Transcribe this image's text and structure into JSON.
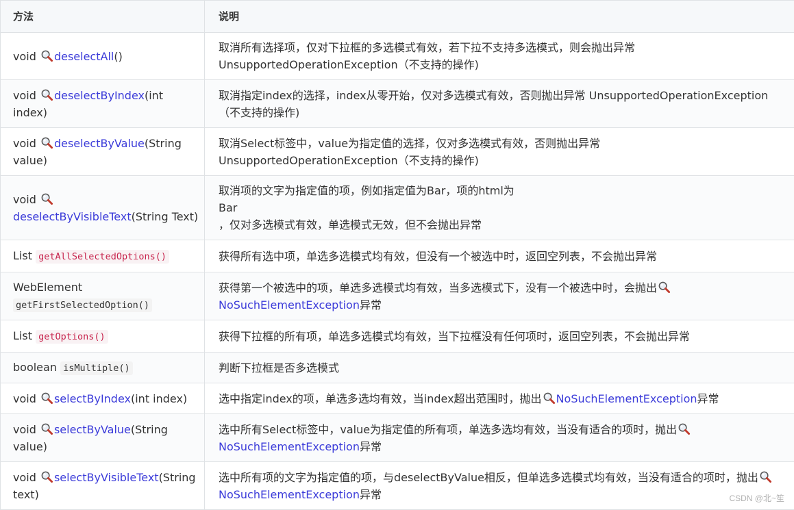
{
  "header": {
    "col_method": "方法",
    "col_desc": "说明"
  },
  "rows": [
    {
      "prefix": "void",
      "name": "deselectAll",
      "suffix": "()",
      "desc": [
        "取消所有选择项，仅对下拉框的多选模式有效，若下拉不支持多选模式，则会抛出异常",
        "UnsupportedOperationException（不支持的操作)"
      ]
    },
    {
      "prefix": "void",
      "name": "deselectByIndex",
      "suffix_a": "(int",
      "suffix_b": "index)",
      "desc": [
        "取消指定index的选择，index从零开始，仅对多选模式有效，否则抛出异常 UnsupportedOperationException",
        "（不支持的操作)"
      ]
    },
    {
      "prefix": "void",
      "name": "deselectByValue",
      "suffix_a": "(String",
      "suffix_b": "value)",
      "desc": [
        "取消Select标签中，value为指定值的选择，仅对多选模式有效，否则抛出异常",
        "UnsupportedOperationException（不支持的操作)"
      ]
    },
    {
      "prefix": "void",
      "name": "deselectByVisibleText",
      "suffix": "(String Text)",
      "desc": [
        "取消项的文字为指定值的项，例如指定值为Bar，项的html为",
        "Bar",
        "，仅对多选模式有效，单选模式无效，但不会抛出异常"
      ]
    },
    {
      "prefix": "List",
      "code": "getAllSelectedOptions()",
      "desc": [
        "获得所有选中项，单选多选模式均有效，但没有一个被选中时，返回空列表，不会抛出异常"
      ]
    },
    {
      "prefix": "WebElement",
      "code": "getFirstSelectedOption()",
      "desc_a": "获得第一个被选中的项，单选多选模式均有效，当多选模式下，没有一个被选中时，会抛出",
      "desc_link": "NoSuchElementException",
      "desc_end": "异常"
    },
    {
      "prefix": "List",
      "code": "getOptions()",
      "desc": [
        "获得下拉框的所有项，单选多选模式均有效，当下拉框没有任何项时，返回空列表，不会抛出异常"
      ]
    },
    {
      "prefix": "boolean",
      "code": "isMultiple()",
      "desc": [
        "判断下拉框是否多选模式"
      ]
    },
    {
      "prefix": "void",
      "name": "selectByIndex",
      "suffix": "(int index)",
      "desc_a": "选中指定index的项，单选多选均有效，当index超出范围时，抛出",
      "desc_link": "NoSuchElementException",
      "desc_end": "异常"
    },
    {
      "prefix": "void",
      "name": "selectByValue",
      "suffix_a": "(String",
      "suffix_b": "value)",
      "desc_a": "选中所有Select标签中，value为指定值的所有项，单选多选均有效，当没有适合的项时，抛出",
      "desc_link": "NoSuchElementException",
      "desc_end": "异常"
    },
    {
      "prefix": "void",
      "name": "selectByVisibleText",
      "suffix_a": "(String",
      "suffix_b": "text)",
      "desc_a": "选中所有项的文字为指定值的项，与deselectByValue相反，但单选多选模式均有效，当没有适合的项时，抛出",
      "desc_link": "NoSuchElementException",
      "desc_end": "异常"
    }
  ],
  "watermark": "CSDN @北~笙",
  "colors": {
    "link": "#3b3bd9",
    "code_pink": "#c7254e",
    "border": "#dfe2e5",
    "header_bg": "#f6f8fa"
  },
  "icons": {
    "search": "magnifier-icon"
  }
}
